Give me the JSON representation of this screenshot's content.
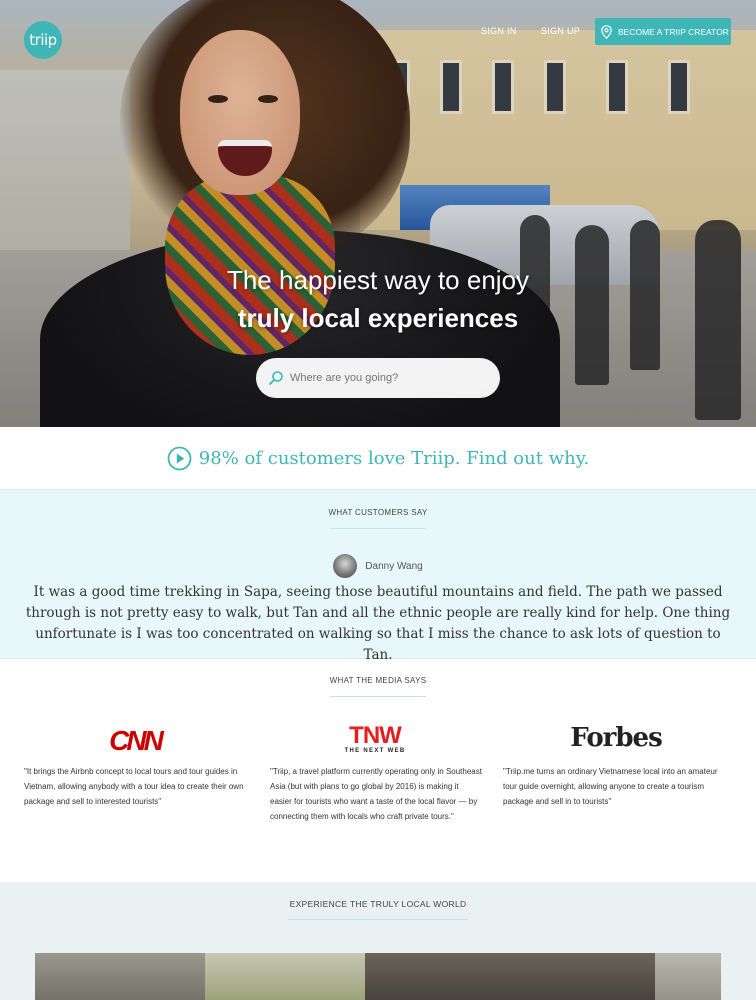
{
  "header": {
    "logo_text": "triip",
    "sign_in": "SIGN IN",
    "sign_up": "SIGN UP",
    "creator_button": "BECOME A TRIIP CREATOR"
  },
  "hero": {
    "line1": "The happiest way to enjoy",
    "line2": "truly local experiences",
    "search_placeholder": "Where are you going?"
  },
  "stats": {
    "text": "98% of customers love Triip. Find out why."
  },
  "testimonial": {
    "label": "WHAT CUSTOMERS SAY",
    "reviewer": "Danny Wang",
    "quote": "It was a good time trekking in Sapa, seeing those beautiful mountains and field. The path we passed through is not pretty easy to walk, but Tan and all the ethnic people are really kind for help. One thing unfortunate is I was too concentrated on walking so that I miss the chance to ask lots of question to Tan."
  },
  "media": {
    "label": "WHAT THE MEDIA SAYS",
    "items": [
      {
        "source": "CNN",
        "quote": "\"It brings the Airbnb concept to local tours and tour guides in Vietnam, allowing anybody with a tour idea to create their own package and sell to interested tourists\""
      },
      {
        "source": "TNW",
        "source_sub": "THE NEXT WEB",
        "quote": "\"Triip, a travel platform currently operating only in Southeast Asia (but with plans to go global by 2016) is making it easier for tourists who want a taste of the local flavor — by connecting them with locals who craft private tours.\""
      },
      {
        "source": "Forbes",
        "quote": "\"Triip.me turns an ordinary Vietnamese local into an amateur tour guide overnight, allowing anyone to create a tourism package and sell in to tourists\""
      }
    ]
  },
  "experience": {
    "label": "EXPERIENCE THE TRULY LOCAL WORLD"
  },
  "colors": {
    "accent": "#3fb6b6",
    "testimonial_bg": "#e8f8fa",
    "experience_bg": "#e9f1f3"
  }
}
